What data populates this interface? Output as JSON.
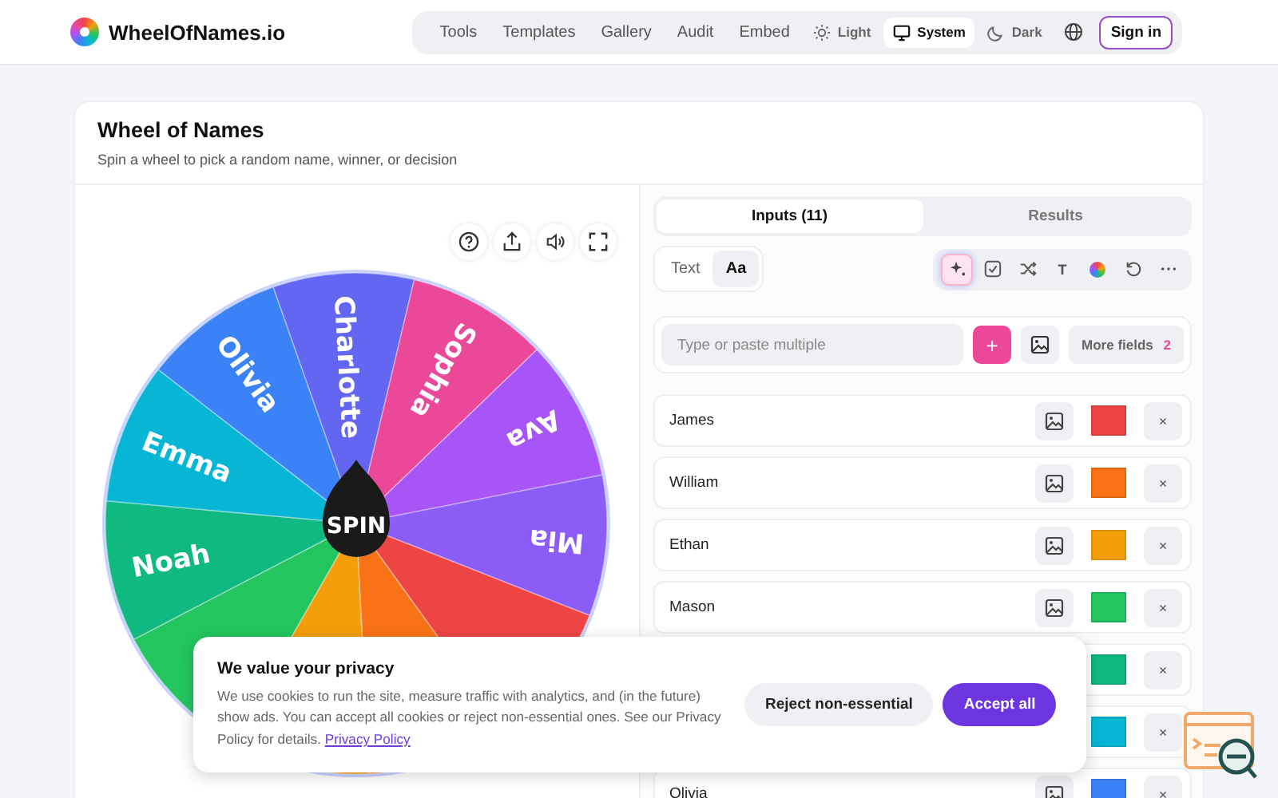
{
  "header": {
    "brand": "WheelOfNames.io",
    "nav": [
      "Tools",
      "Templates",
      "Gallery",
      "Audit",
      "Embed"
    ],
    "themes": [
      {
        "kind": "light",
        "label": "Light",
        "selected": false
      },
      {
        "kind": "system",
        "label": "System",
        "selected": true
      },
      {
        "kind": "dark",
        "label": "Dark",
        "selected": false
      }
    ],
    "sign_in": "Sign in"
  },
  "card": {
    "title": "Wheel of Names",
    "subtitle": "Spin a wheel to pick a random name, winner, or decision"
  },
  "wheel": {
    "spin": "SPIN",
    "segments": [
      {
        "label": "Charlotte",
        "color": "#6366f1"
      },
      {
        "label": "Sophia",
        "color": "#ec4899"
      },
      {
        "label": "Ava",
        "color": "#a855f7"
      },
      {
        "label": "Mia",
        "color": "#8b5cf6"
      },
      {
        "color": "#ef4444"
      },
      {
        "color": "#f97316"
      },
      {
        "color": "#f59e0b"
      },
      {
        "color": "#22c55e"
      },
      {
        "label": "Noah",
        "color": "#10b981"
      },
      {
        "label": "Emma",
        "color": "#06b6d4"
      },
      {
        "label": "Olivia",
        "color": "#3b82f6"
      }
    ]
  },
  "tabs": [
    {
      "label": "Inputs (11)",
      "selected": true
    },
    {
      "label": "Results",
      "selected": false
    }
  ],
  "modes": [
    {
      "label": "Text",
      "selected": false
    },
    {
      "label": "Aa",
      "selected": true
    }
  ],
  "tools": [
    {
      "kind": "sparkle",
      "selected": true
    },
    {
      "kind": "check",
      "selected": false
    },
    {
      "kind": "shuffle",
      "selected": false
    },
    {
      "kind": "text",
      "label": "T",
      "selected": false
    },
    {
      "kind": "colors",
      "selected": false
    },
    {
      "kind": "reset",
      "selected": false
    },
    {
      "kind": "more",
      "selected": false
    }
  ],
  "entry": {
    "placeholder": "Type or paste multiple",
    "add": "+",
    "more_fields": "More fields",
    "more_count": "2"
  },
  "entries": [
    {
      "name": "James",
      "color": "#ef4444",
      "remove": "×"
    },
    {
      "name": "William",
      "color": "#f97316",
      "remove": "×"
    },
    {
      "name": "Ethan",
      "color": "#f59e0b",
      "remove": "×"
    },
    {
      "name": "Mason",
      "color": "#22c55e",
      "remove": "×"
    },
    {
      "color": "#10b981",
      "remove": "×"
    },
    {
      "color": "#06b6d4",
      "remove": "×"
    },
    {
      "name": "Olivia",
      "color": "#3b82f6",
      "remove": "×"
    }
  ],
  "cookie": {
    "title": "We value your privacy",
    "text": "We use cookies to run the site, measure traffic with analytics, and (in the future) show ads. You can accept all cookies or reject non-essential ones. See our Privacy Policy for details.",
    "link": "Privacy Policy",
    "reject": "Reject non-essential",
    "accept": "Accept all"
  }
}
